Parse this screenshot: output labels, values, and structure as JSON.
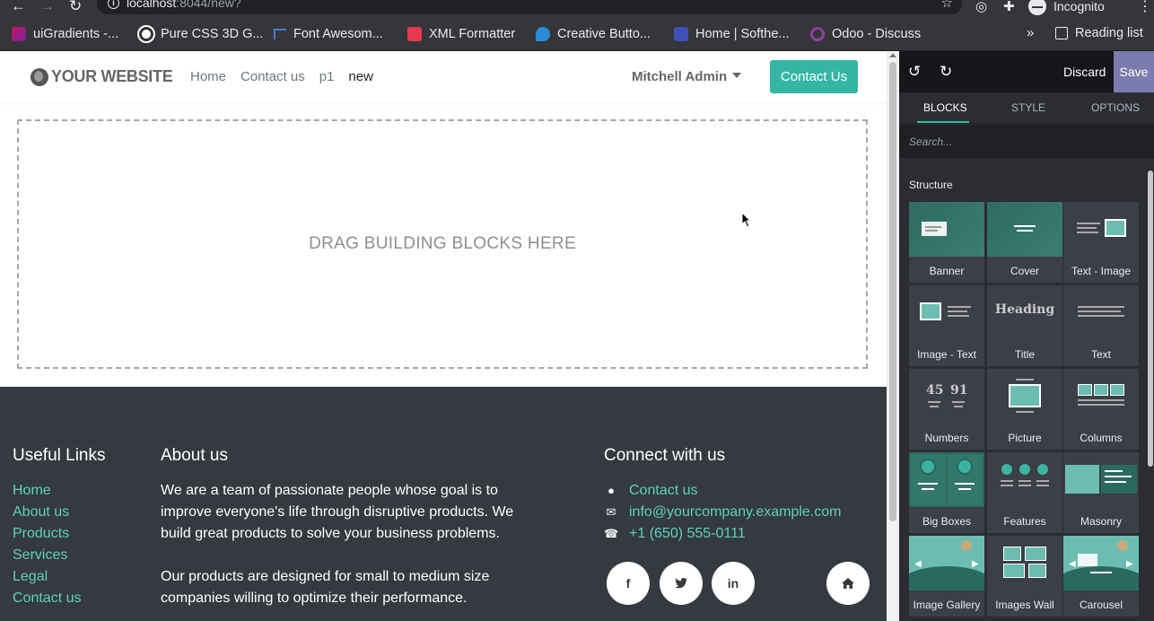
{
  "browser": {
    "url_host": "localhost",
    "url_rest": ":8044/new?",
    "profile_label": "Incognito",
    "bookmarks": [
      {
        "label": "uiGradients -...",
        "color": "#c2185b"
      },
      {
        "label": "Pure CSS 3D G...",
        "color": "#ffffff"
      },
      {
        "label": "Font Awesom...",
        "color": "#4a7bd6"
      },
      {
        "label": "XML Formatter",
        "color": "#e53950"
      },
      {
        "label": "Creative Butto...",
        "color": "#2b8bd6"
      },
      {
        "label": "Home | Softhe...",
        "color": "#3f51b5"
      },
      {
        "label": "Odoo - Discuss",
        "color": "#8e3fa0"
      }
    ],
    "more_label": "»",
    "reading_list_label": "Reading list"
  },
  "site": {
    "logo_text": "YOUR WEBSITE",
    "menu": [
      {
        "label": "Home"
      },
      {
        "label": "Contact us"
      },
      {
        "label": "p1"
      },
      {
        "label": "new"
      }
    ],
    "user_name": "Mitchell Admin",
    "cta_label": "Contact Us",
    "dropzone_text": "DRAG BUILDING BLOCKS HERE",
    "footer": {
      "links_title": "Useful Links",
      "links": [
        "Home",
        "About us",
        "Products",
        "Services",
        "Legal",
        "Contact us"
      ],
      "about_title": "About us",
      "about_p1": "We are a team of passionate people whose goal is to improve everyone's life through disruptive products. We build great products to solve your business problems.",
      "about_p2": "Our products are designed for small to medium size companies willing to optimize their performance.",
      "connect_title": "Connect with us",
      "contact_label": "Contact us",
      "email": "info@yourcompany.example.com",
      "phone": "+1 (650) 555-0111",
      "social": [
        "f",
        "t",
        "in",
        "home"
      ]
    }
  },
  "editor": {
    "discard_label": "Discard",
    "save_label": "Save",
    "tabs": [
      "BLOCKS",
      "STYLE",
      "OPTIONS"
    ],
    "search_placeholder": "Search...",
    "section_title": "Structure",
    "blocks": [
      "Banner",
      "Cover",
      "Text - Image",
      "Image - Text",
      "Title",
      "Text",
      "Numbers",
      "Picture",
      "Columns",
      "Big Boxes",
      "Features",
      "Masonry",
      "Image Gallery",
      "Images Wall",
      "Carousel"
    ],
    "title_heading_sample": "Heading",
    "numbers_sample": [
      "45",
      "91"
    ],
    "accent_color": "#35b6a4",
    "save_color": "#7c7bad"
  }
}
